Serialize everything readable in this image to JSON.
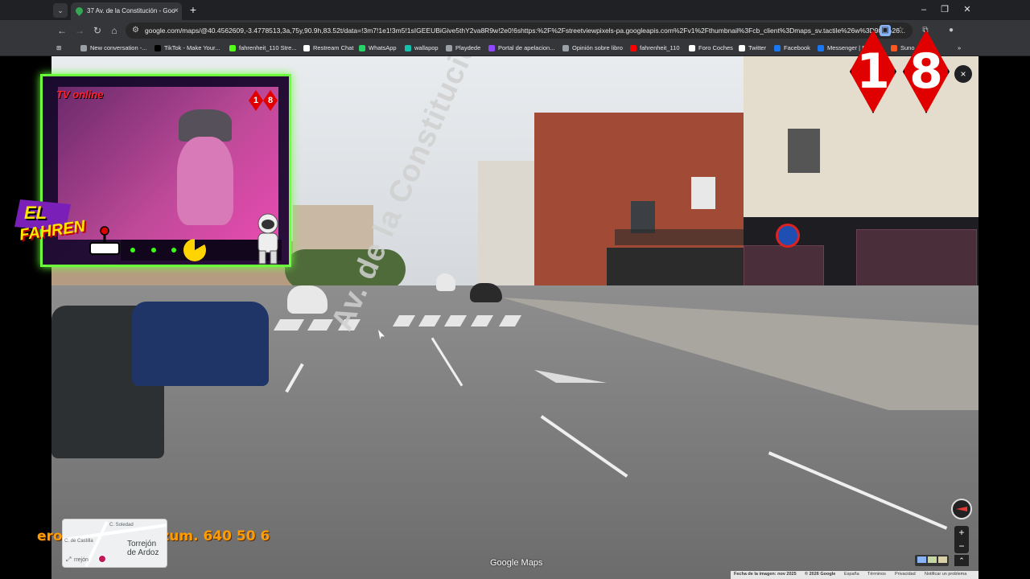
{
  "browser": {
    "tab_title": "37 Av. de la Constitución - Goo",
    "url": "google.com/maps/@40.4562609,-3.4778513,3a,75y,90.9h,83.52t/data=!3m7!1e1!3m5!1sIGEEUBiGive5thY2va8R9w!2e0!6shttps:%2F%2Fstreetviewpixels-pa.googleapis.com%2Fv1%2Fthumbnail%3Fcb_client%3Dmaps_sv.tactile%26w%3D900%26...",
    "bookmarks": [
      {
        "label": "New conversation -...",
        "color": "#9aa0a6"
      },
      {
        "label": "TikTok - Make Your...",
        "color": "#000000"
      },
      {
        "label": "fahrenheit_110 Stre...",
        "color": "#53fc18"
      },
      {
        "label": "Restream Chat",
        "color": "#ffffff"
      },
      {
        "label": "WhatsApp",
        "color": "#25d366"
      },
      {
        "label": "wallapop",
        "color": "#13c1ac"
      },
      {
        "label": "Playdede",
        "color": "#9aa0a6"
      },
      {
        "label": "Portal de apelacion...",
        "color": "#9146ff"
      },
      {
        "label": "Opinión sobre libro",
        "color": "#9aa0a6"
      },
      {
        "label": "fahrenheit_110",
        "color": "#ff0000"
      },
      {
        "label": "Foro Coches",
        "color": "#ffffff"
      },
      {
        "label": "Twitter",
        "color": "#ffffff"
      },
      {
        "label": "Facebook",
        "color": "#1877f2"
      },
      {
        "label": "Messenger | Fa",
        "color": "#1877f2"
      },
      {
        "label": "Suno",
        "color": "#ff5722"
      }
    ]
  },
  "street_view": {
    "road_text": "Av. de la Constitución",
    "close_icon": "×",
    "logo": "Google Maps",
    "footer": {
      "image_date": "Fecha de la imagen: nov 2025",
      "copyright": "© 2026 Google",
      "country": "España",
      "terms": "Términos",
      "privacy": "Privacidad",
      "report": "Notificar un problema"
    },
    "zoom_in": "+",
    "zoom_out": "−"
  },
  "minimap": {
    "street1": "C. Soledad",
    "street2": "C. de Castilla",
    "city_line1": "Torrejón",
    "city_line2": "de Ardoz",
    "nearby": "rrejón"
  },
  "overlay": {
    "rating_digit1": "1",
    "rating_digit2": "8",
    "tv_online": "TV online",
    "el": "EL",
    "fahren": "FAHREN",
    "ticker": "ero Alice........Bizum. 640 50 6"
  }
}
